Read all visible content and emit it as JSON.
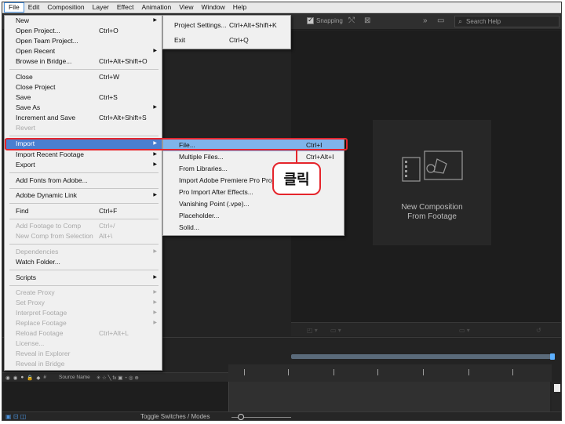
{
  "menubar": {
    "items": [
      "File",
      "Edit",
      "Composition",
      "Layer",
      "Effect",
      "Animation",
      "View",
      "Window",
      "Help"
    ]
  },
  "toolbar": {
    "snapping_label": "Snapping",
    "search_placeholder": "Search Help"
  },
  "file_menu": {
    "items": [
      {
        "label": "New",
        "shortcut": "",
        "arrow": true,
        "disabled": false
      },
      {
        "label": "Open Project...",
        "shortcut": "Ctrl+O",
        "arrow": false,
        "disabled": false
      },
      {
        "label": "Open Team Project...",
        "shortcut": "",
        "arrow": false,
        "disabled": false
      },
      {
        "label": "Open Recent",
        "shortcut": "",
        "arrow": true,
        "disabled": false
      },
      {
        "label": "Browse in Bridge...",
        "shortcut": "Ctrl+Alt+Shift+O",
        "arrow": false,
        "disabled": false
      },
      {
        "label": "Close",
        "shortcut": "Ctrl+W",
        "arrow": false,
        "disabled": false
      },
      {
        "label": "Close Project",
        "shortcut": "",
        "arrow": false,
        "disabled": false
      },
      {
        "label": "Save",
        "shortcut": "Ctrl+S",
        "arrow": false,
        "disabled": false
      },
      {
        "label": "Save As",
        "shortcut": "",
        "arrow": true,
        "disabled": false
      },
      {
        "label": "Increment and Save",
        "shortcut": "Ctrl+Alt+Shift+S",
        "arrow": false,
        "disabled": false
      },
      {
        "label": "Revert",
        "shortcut": "",
        "arrow": false,
        "disabled": true
      },
      {
        "label": "Import",
        "shortcut": "",
        "arrow": true,
        "disabled": false
      },
      {
        "label": "Import Recent Footage",
        "shortcut": "",
        "arrow": true,
        "disabled": false
      },
      {
        "label": "Export",
        "shortcut": "",
        "arrow": true,
        "disabled": false
      },
      {
        "label": "Add Fonts from Adobe...",
        "shortcut": "",
        "arrow": false,
        "disabled": false
      },
      {
        "label": "Adobe Dynamic Link",
        "shortcut": "",
        "arrow": true,
        "disabled": false
      },
      {
        "label": "Find",
        "shortcut": "Ctrl+F",
        "arrow": false,
        "disabled": false
      },
      {
        "label": "Add Footage to Comp",
        "shortcut": "Ctrl+/",
        "arrow": false,
        "disabled": true
      },
      {
        "label": "New Comp from Selection",
        "shortcut": "Alt+\\",
        "arrow": false,
        "disabled": true
      },
      {
        "label": "Dependencies",
        "shortcut": "",
        "arrow": true,
        "disabled": true
      },
      {
        "label": "Watch Folder...",
        "shortcut": "",
        "arrow": false,
        "disabled": false
      },
      {
        "label": "Scripts",
        "shortcut": "",
        "arrow": true,
        "disabled": false
      },
      {
        "label": "Create Proxy",
        "shortcut": "",
        "arrow": true,
        "disabled": true
      },
      {
        "label": "Set Proxy",
        "shortcut": "",
        "arrow": true,
        "disabled": true
      },
      {
        "label": "Interpret Footage",
        "shortcut": "",
        "arrow": true,
        "disabled": true
      },
      {
        "label": "Replace Footage",
        "shortcut": "",
        "arrow": true,
        "disabled": true
      },
      {
        "label": "Reload Footage",
        "shortcut": "Ctrl+Alt+L",
        "arrow": false,
        "disabled": true
      },
      {
        "label": "License...",
        "shortcut": "",
        "arrow": false,
        "disabled": true
      },
      {
        "label": "Reveal in Explorer",
        "shortcut": "",
        "arrow": false,
        "disabled": true
      },
      {
        "label": "Reveal in Bridge",
        "shortcut": "",
        "arrow": false,
        "disabled": true
      }
    ]
  },
  "project_menu": {
    "items": [
      {
        "label": "Project Settings...",
        "shortcut": "Ctrl+Alt+Shift+K"
      },
      {
        "label": "Exit",
        "shortcut": "Ctrl+Q"
      }
    ]
  },
  "import_menu": {
    "items": [
      {
        "label": "File...",
        "shortcut": "Ctrl+I"
      },
      {
        "label": "Multiple Files...",
        "shortcut": "Ctrl+Alt+I"
      },
      {
        "label": "From Libraries...",
        "shortcut": ""
      },
      {
        "label": "Import Adobe Premiere Pro Project...",
        "shortcut": ""
      },
      {
        "label": "Pro Import After Effects...",
        "shortcut": ""
      },
      {
        "label": "Vanishing Point (.vpe)...",
        "shortcut": ""
      },
      {
        "label": "Placeholder...",
        "shortcut": ""
      },
      {
        "label": "Solid...",
        "shortcut": ""
      }
    ]
  },
  "composition_panel": {
    "line1": "New Composition",
    "line2": "From Footage"
  },
  "timeline": {
    "source_name": "Source Name",
    "toggle_label": "Toggle Switches / Modes"
  },
  "annotation": {
    "callout_text": "클릭",
    "color": "#e5252c"
  }
}
